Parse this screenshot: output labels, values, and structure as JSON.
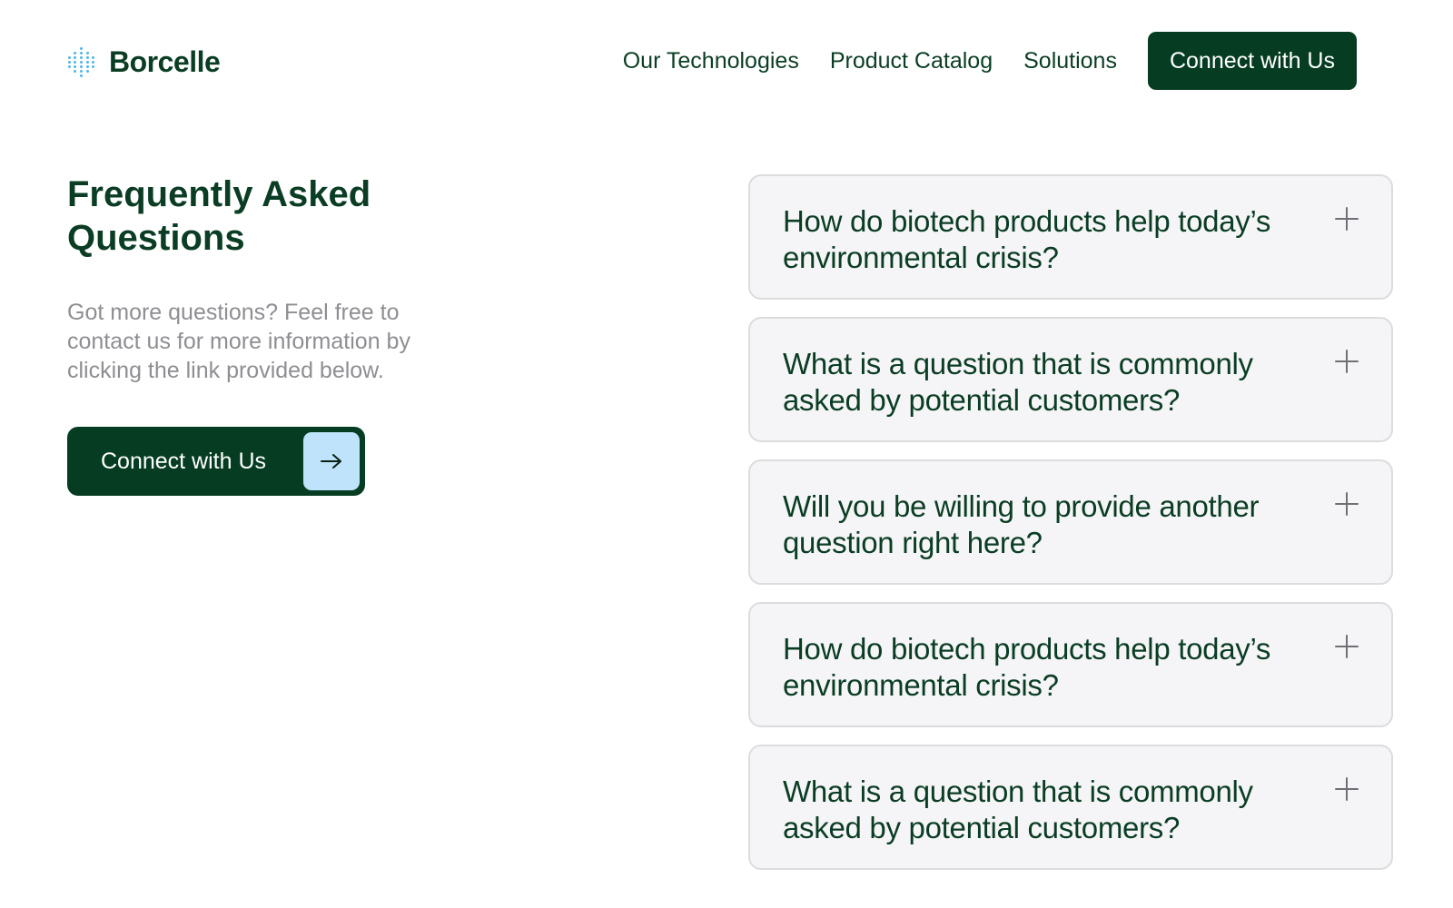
{
  "brand": {
    "name": "Borcelle",
    "accent_color": "#063d22",
    "icon_color": "#4fb6e8",
    "icon": "dotted-bars-logo-icon"
  },
  "nav": {
    "links": [
      "Our Technologies",
      "Product Catalog",
      "Solutions"
    ],
    "button_label": "Connect with Us"
  },
  "intro": {
    "title": "Frequently Asked Questions",
    "text": "Got more questions? Feel free to contact us for more information by clicking the link provided below.",
    "cta_label": "Connect with Us",
    "cta_icon": "arrow-right-icon"
  },
  "faq": {
    "toggle_icon": "plus-icon",
    "items": [
      {
        "question": "How do biotech products help today’s environmental crisis?"
      },
      {
        "question": "What is a question that is commonly asked by potential customers?"
      },
      {
        "question": "Will you be willing to provide another question right here?"
      },
      {
        "question": "How do biotech products help today’s environmental crisis?"
      },
      {
        "question": "What is a question that is commonly asked by potential customers?"
      }
    ]
  }
}
